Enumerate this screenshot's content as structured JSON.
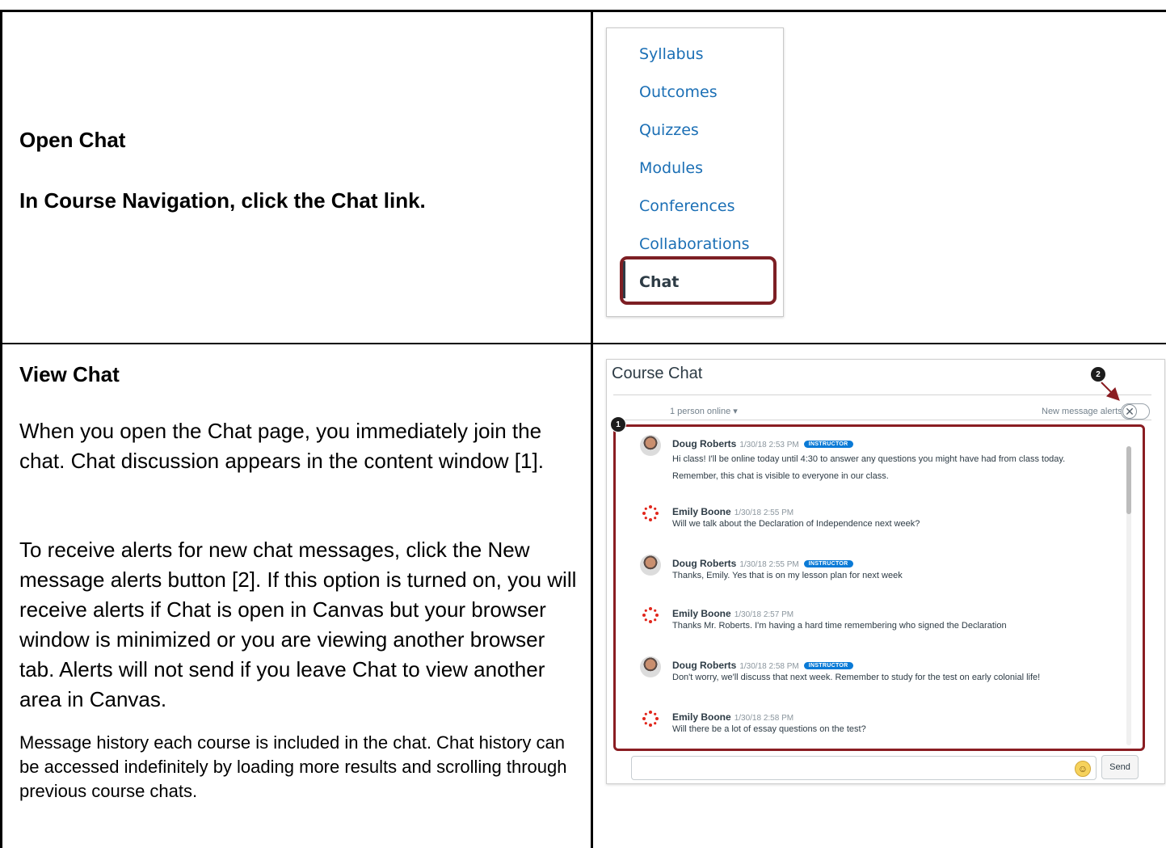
{
  "step1": {
    "heading": "Open Chat",
    "instruction": "In Course Navigation, click the Chat link.",
    "nav_items": [
      "Syllabus",
      "Outcomes",
      "Quizzes",
      "Modules",
      "Conferences",
      "Collaborations",
      "Chat"
    ]
  },
  "step2": {
    "heading": "View Chat",
    "para1": "When you open the Chat page, you immediately join the chat. Chat discussion appears in the content window [1].",
    "para2": "To receive alerts for new chat messages, click the New message alerts button [2]. If this option is turned on, you will receive alerts if Chat is open in Canvas but your browser window is minimized or you are viewing another browser tab. Alerts will not send if you leave Chat to view another area in Canvas.",
    "para3": "Message history each course is included in the chat. Chat history can be accessed indefinitely by loading more results and scrolling through previous course chats."
  },
  "chat": {
    "title": "Course Chat",
    "online": "1 person online ▾",
    "alerts_label": "New message alerts",
    "toggle_glyph": "✕",
    "callout_1": "1",
    "callout_2": "2",
    "send_label": "Send",
    "emoji_glyph": "☺",
    "instructor_badge": "INSTRUCTOR",
    "messages": [
      {
        "name": "Doug Roberts",
        "time": "1/30/18 2:53 PM",
        "role": "instructor",
        "lines": [
          "Hi class! I'll be online today until 4:30 to answer any questions you might have had from class today.",
          "Remember, this chat is visible to everyone in our class."
        ]
      },
      {
        "name": "Emily Boone",
        "time": "1/30/18 2:55 PM",
        "role": "student",
        "lines": [
          "Will we talk about the Declaration of Independence next week?"
        ]
      },
      {
        "name": "Doug Roberts",
        "time": "1/30/18 2:55 PM",
        "role": "instructor",
        "lines": [
          "Thanks, Emily. Yes that is on my lesson plan for next week"
        ]
      },
      {
        "name": "Emily Boone",
        "time": "1/30/18 2:57 PM",
        "role": "student",
        "lines": [
          "Thanks Mr. Roberts. I'm having a hard time remembering who signed the Declaration"
        ]
      },
      {
        "name": "Doug Roberts",
        "time": "1/30/18 2:58 PM",
        "role": "instructor",
        "lines": [
          "Don't worry, we'll discuss that next week. Remember to study for the test on early colonial life!"
        ]
      },
      {
        "name": "Emily Boone",
        "time": "1/30/18 2:58 PM",
        "role": "student",
        "lines": [
          "Will there be a lot of essay questions on the test?"
        ]
      }
    ]
  },
  "colors": {
    "link_blue": "#1b6fb5",
    "highlight_red": "#8a1d22",
    "badge_blue": "#0a7ad6"
  }
}
